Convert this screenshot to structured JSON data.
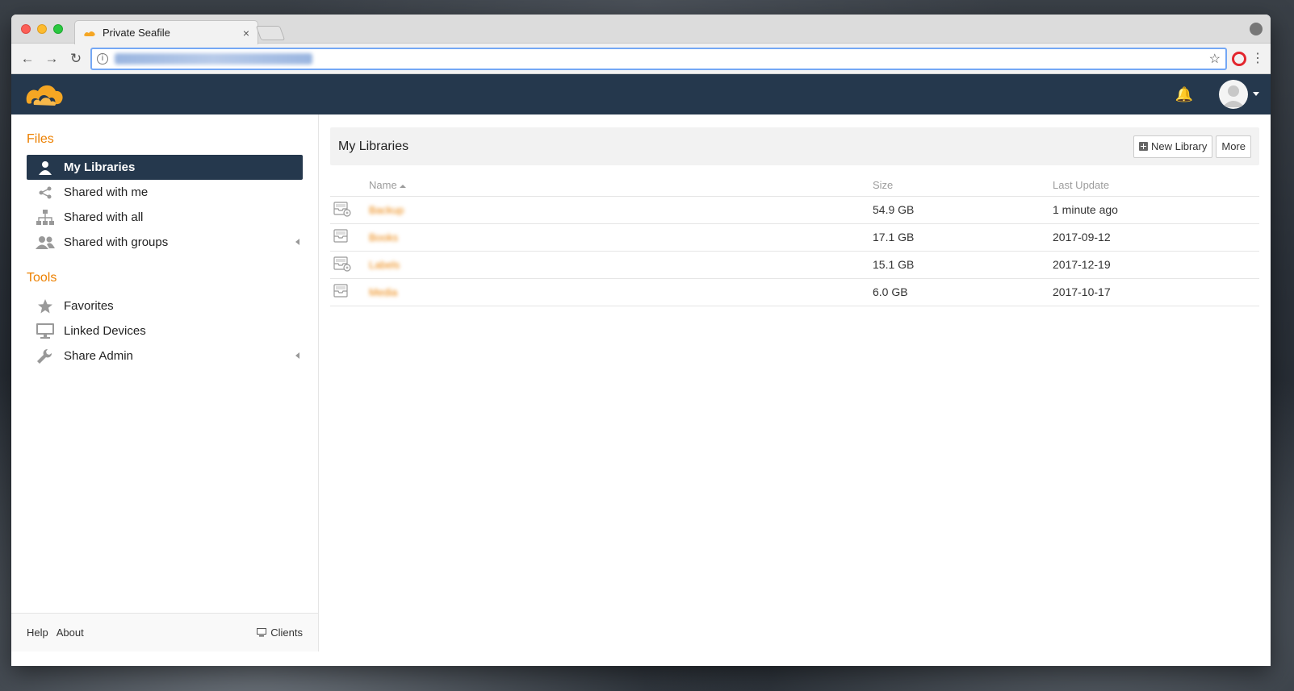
{
  "browser": {
    "tab_title": "Private Seafile",
    "tab_close": "×",
    "url": "seafile.example.server.com/my-libs"
  },
  "sidebar": {
    "files_heading": "Files",
    "files_items": [
      {
        "label": "My Libraries",
        "icon": "user-icon",
        "active": true
      },
      {
        "label": "Shared with me",
        "icon": "share-icon"
      },
      {
        "label": "Shared with all",
        "icon": "org-chart-icon"
      },
      {
        "label": "Shared with groups",
        "icon": "group-icon"
      }
    ],
    "tools_heading": "Tools",
    "tools_items": [
      {
        "label": "Favorites",
        "icon": "star-icon"
      },
      {
        "label": "Linked Devices",
        "icon": "monitor-icon"
      },
      {
        "label": "Share Admin",
        "icon": "wrench-icon"
      }
    ],
    "footer": {
      "help": "Help",
      "about": "About",
      "clients": "Clients"
    }
  },
  "main": {
    "title": "My Libraries",
    "new_library": "New Library",
    "more": "More",
    "columns": {
      "name": "Name",
      "size": "Size",
      "last_update": "Last Update"
    },
    "rows": [
      {
        "name": "Backup",
        "size": "54.9 GB",
        "updated": "1 minute ago",
        "icon": "library-encrypted-icon"
      },
      {
        "name": "Books",
        "size": "17.1 GB",
        "updated": "2017-09-12",
        "icon": "library-icon"
      },
      {
        "name": "Labels",
        "size": "15.1 GB",
        "updated": "2017-12-19",
        "icon": "library-encrypted-icon"
      },
      {
        "name": "Media",
        "size": "6.0 GB",
        "updated": "2017-10-17",
        "icon": "library-icon"
      }
    ]
  },
  "colors": {
    "accent": "#ec8000",
    "header": "#25384d"
  }
}
